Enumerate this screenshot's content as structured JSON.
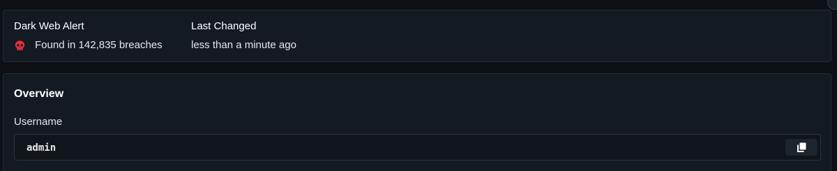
{
  "alert": {
    "dark_web": {
      "title": "Dark Web Alert",
      "value": "Found in 142,835 breaches",
      "icon": "skull-icon",
      "icon_color": "#e5303c"
    },
    "last_changed": {
      "title": "Last Changed",
      "value": "less than a minute ago"
    }
  },
  "overview": {
    "title": "Overview",
    "fields": [
      {
        "label": "Username",
        "value": "admin",
        "action_icon": "copy-icon"
      }
    ]
  }
}
